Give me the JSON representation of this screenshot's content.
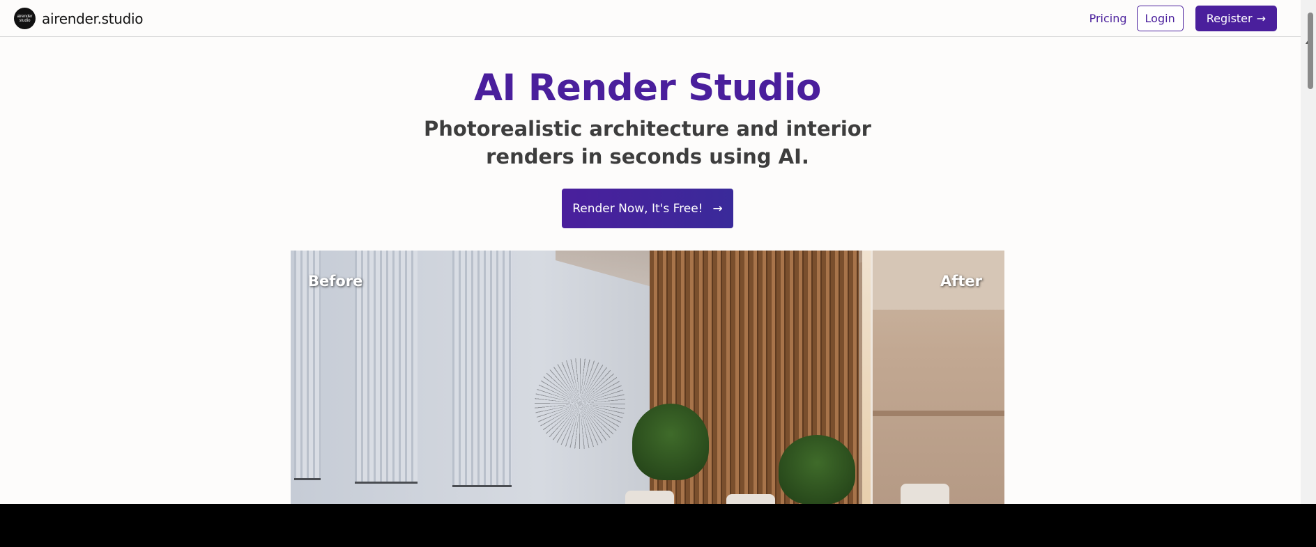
{
  "header": {
    "logo_badge_line1": "airender",
    "logo_badge_line2": "studio",
    "brand": "airender.studio",
    "nav": {
      "pricing": "Pricing",
      "login": "Login",
      "register": "Register",
      "register_arrow": "→"
    }
  },
  "hero": {
    "title": "AI Render Studio",
    "subtitle_line1": "Photorealistic architecture and interior",
    "subtitle_line2": "renders in seconds using AI.",
    "cta_label": "Render Now, It's Free!",
    "cta_arrow": "→"
  },
  "compare": {
    "before_label": "Before",
    "after_label": "After"
  },
  "colors": {
    "accent": "#4a1f9c",
    "text_dark": "#3d3d3d",
    "background": "#fdfcfb"
  }
}
